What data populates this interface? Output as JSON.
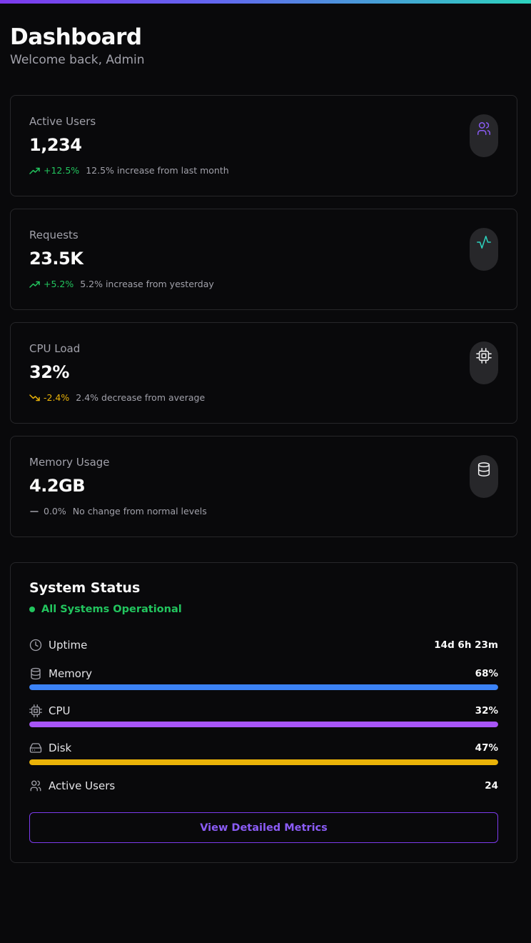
{
  "header": {
    "title": "Dashboard",
    "subtitle": "Welcome back, Admin"
  },
  "cards": [
    {
      "label": "Active Users",
      "value": "1,234",
      "change": "+12.5%",
      "trend": "up",
      "description": "12.5% increase from last month",
      "icon": "users-icon",
      "icon_color": "#8b5cf6"
    },
    {
      "label": "Requests",
      "value": "23.5K",
      "change": "+5.2%",
      "trend": "up",
      "description": "5.2% increase from yesterday",
      "icon": "activity-icon",
      "icon_color": "#2dd4bf"
    },
    {
      "label": "CPU Load",
      "value": "32%",
      "change": "-2.4%",
      "trend": "down",
      "description": "2.4% decrease from average",
      "icon": "cpu-icon",
      "icon_color": "#f4f4f5"
    },
    {
      "label": "Memory Usage",
      "value": "4.2GB",
      "change": "0.0%",
      "trend": "flat",
      "description": "No change from normal levels",
      "icon": "database-icon",
      "icon_color": "#f4f4f5"
    }
  ],
  "system_status": {
    "title": "System Status",
    "status_text": "All Systems Operational",
    "rows": [
      {
        "label": "Uptime",
        "value": "14d 6h 23m",
        "icon": "clock-icon"
      },
      {
        "label": "Memory",
        "value": "68%",
        "icon": "database-icon",
        "progress": 1.0,
        "color": "#3b82f6"
      },
      {
        "label": "CPU",
        "value": "32%",
        "icon": "cpu-icon",
        "progress": 1.0,
        "color": "#a855f7"
      },
      {
        "label": "Disk",
        "value": "47%",
        "icon": "hard-drive-icon",
        "progress": 1.0,
        "color": "#eab308"
      },
      {
        "label": "Active Users",
        "value": "24",
        "icon": "users-icon"
      }
    ],
    "button_label": "View Detailed Metrics"
  },
  "colors": {
    "background": "#09090b",
    "border": "#27272a",
    "accent": "#7c3aed",
    "success": "#22c55e",
    "warning": "#eab308"
  }
}
